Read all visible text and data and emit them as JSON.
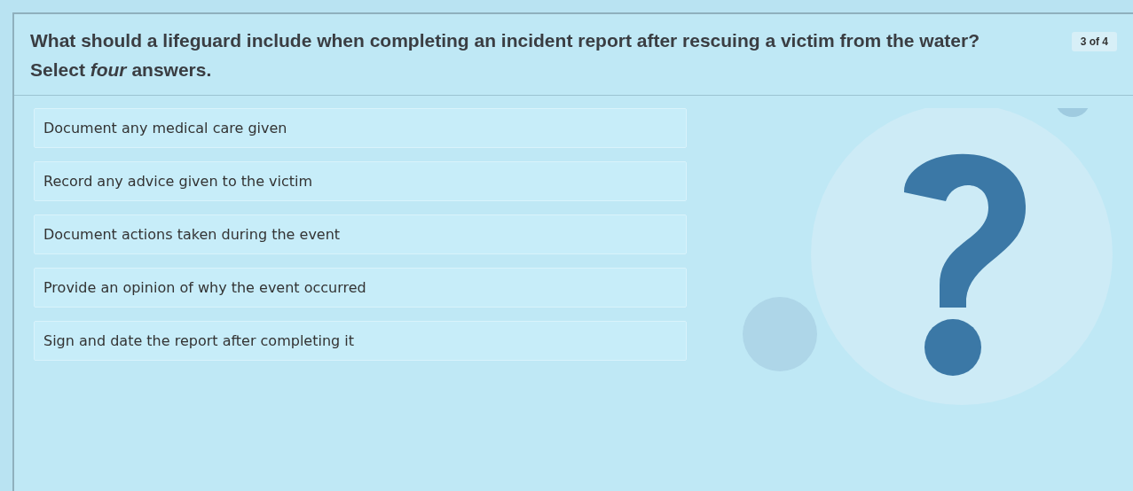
{
  "question": {
    "text": "What should a lifeguard include when completing an incident report after rescuing a victim from the water? Select *four* answers.",
    "progress": "3 of 4"
  },
  "options": [
    {
      "label": "Document any medical care given",
      "selected": false
    },
    {
      "label": "Record any advice given to the victim",
      "selected": false
    },
    {
      "label": "Document actions taken during the event",
      "selected": false
    },
    {
      "label": "Provide an opinion of why the event occurred",
      "selected": false
    },
    {
      "label": "Sign and date the report after completing it",
      "selected": false
    }
  ]
}
